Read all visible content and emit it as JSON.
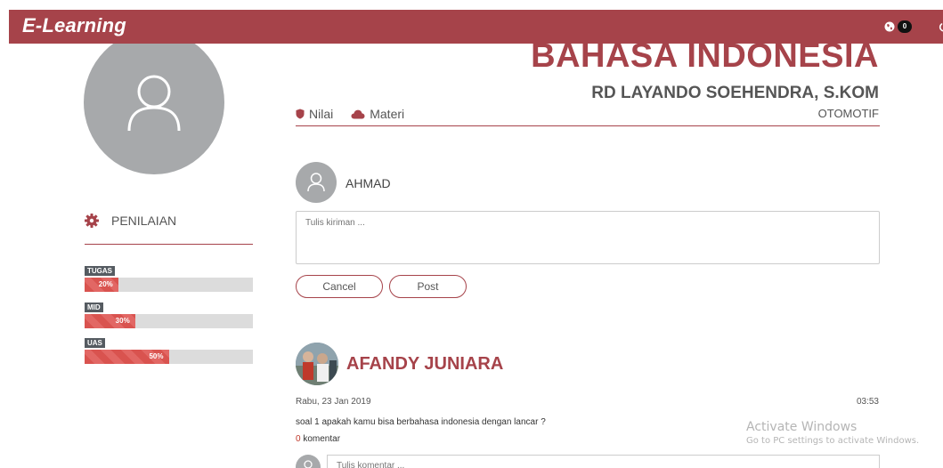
{
  "app": {
    "brand": "E-Learning",
    "notification_count": "0"
  },
  "course": {
    "title": "BAHASA INDONESIA",
    "teacher": "RD LAYANDO SOEHENDRA, S.KOM",
    "department": "OTOMOTIF",
    "tabs": [
      {
        "label": "Nilai",
        "icon": "shield-icon"
      },
      {
        "label": "Materi",
        "icon": "cloud-icon"
      }
    ]
  },
  "colors": {
    "accent": "#a6434a",
    "progress": "#d9534f",
    "tag": "#555b61"
  },
  "penilaian": {
    "title": "PENILAIAN",
    "items": [
      {
        "tag": "TUGAS",
        "percent_label": "20%",
        "value": 20
      },
      {
        "tag": "MID",
        "percent_label": "30%",
        "value": 30
      },
      {
        "tag": "UAS",
        "percent_label": "50%",
        "value": 50
      }
    ]
  },
  "composer": {
    "user_name": "AHMAD",
    "placeholder": "Tulis kiriman ...",
    "cancel_label": "Cancel",
    "post_label": "Post"
  },
  "post": {
    "author": "AFANDY JUNIARA",
    "date": "Rabu, 23 Jan 2019",
    "time": "03:53",
    "text": "soal 1 apakah kamu bisa berbahasa indonesia dengan lancar ?",
    "comment_count": "0",
    "comment_label": "komentar",
    "comment_placeholder": "Tulis komentar ..."
  },
  "watermark": {
    "title": "Activate Windows",
    "subtitle": "Go to PC settings to activate Windows."
  }
}
